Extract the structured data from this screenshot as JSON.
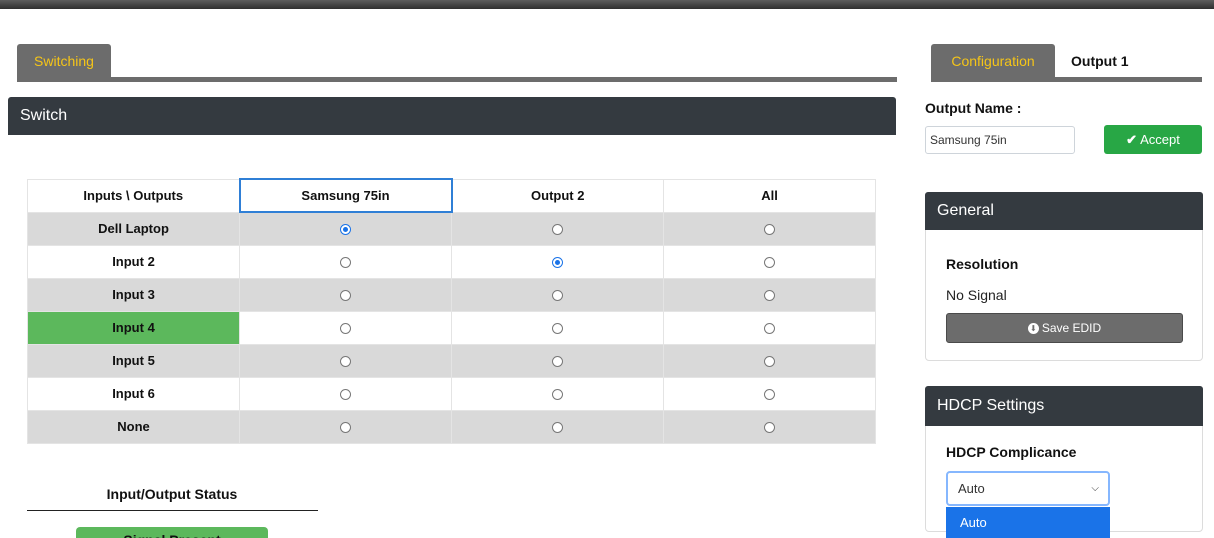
{
  "tabs": {
    "switching": "Switching",
    "configuration": "Configuration",
    "output": "Output 1"
  },
  "switch_panel": {
    "title": "Switch",
    "corner_header": "Inputs \\ Outputs",
    "columns": [
      "Samsung 75in",
      "Output 2",
      "All"
    ],
    "rows": [
      "Dell Laptop",
      "Input 2",
      "Input 3",
      "Input 4",
      "Input 5",
      "Input 6",
      "None"
    ],
    "selected": [
      [
        "checked",
        "",
        ""
      ],
      [
        "",
        "checked",
        ""
      ],
      [
        "",
        "",
        ""
      ],
      [
        "",
        "",
        ""
      ],
      [
        "",
        "",
        ""
      ],
      [
        "",
        "",
        ""
      ],
      [
        "",
        "",
        ""
      ]
    ],
    "active_input": "Input 4"
  },
  "status": {
    "title": "Input/Output Status",
    "badge": "Signal Present"
  },
  "config": {
    "output_name_label": "Output Name :",
    "output_name_value": "Samsung 75in",
    "accept_label": "Accept",
    "general_title": "General",
    "resolution_label": "Resolution",
    "resolution_value": "No Signal",
    "save_edid_label": "Save EDID",
    "hdcp_title": "HDCP Settings",
    "hdcp_compliance_label": "HDCP Complicance",
    "hdcp_selected": "Auto",
    "hdcp_highlight_option": "Auto"
  },
  "colors": {
    "tab": "#6c6c6c",
    "tab_text": "#f5c518",
    "header": "#343a40",
    "accent_green": "#5cb85c",
    "accept_green": "#28a745",
    "radio_blue": "#1a73e8"
  }
}
